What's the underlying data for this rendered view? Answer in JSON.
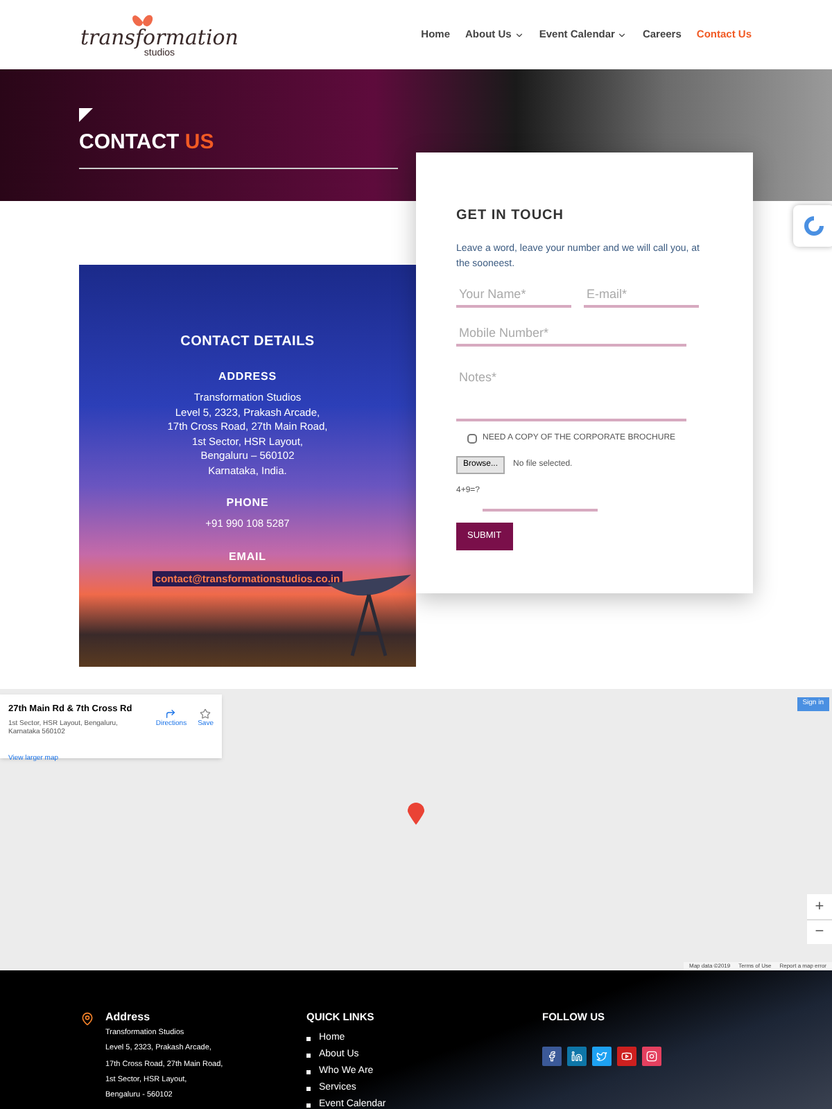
{
  "nav": {
    "logo": {
      "name": "transformation",
      "sub": "studios"
    },
    "items": [
      {
        "label": "Home",
        "selected": false,
        "dropdown": false
      },
      {
        "label": "About Us",
        "selected": false,
        "dropdown": true
      },
      {
        "label": "Event Calendar",
        "selected": false,
        "dropdown": true
      },
      {
        "label": "Careers",
        "selected": false,
        "dropdown": false
      },
      {
        "label": "Contact Us",
        "selected": true,
        "dropdown": false
      }
    ]
  },
  "banner": {
    "title": "CONTACT",
    "title_accent": "US"
  },
  "contact_details": {
    "heading": "CONTACT DETAILS",
    "sections": [
      {
        "heading": "ADDRESS",
        "kind": "text",
        "lines": [
          "Transformation Studios",
          "Level 5, 2323, Prakash Arcade,",
          "17th Cross Road, 27th Main Road,",
          "1st Sector, HSR Layout,",
          "Bengaluru – 560102",
          "Karnataka, India."
        ]
      },
      {
        "heading": "PHONE",
        "kind": "text",
        "lines": [
          "+91 990 108 5287"
        ]
      },
      {
        "heading": "EMAIL",
        "kind": "link",
        "lines": [
          "contact@transformationstudios.co.in"
        ]
      }
    ]
  },
  "form": {
    "heading": "GET IN TOUCH",
    "intro": "Leave a word, leave your number and we will call you, at the sooneest.",
    "fields": [
      {
        "placeholder": "Your Name*",
        "kind": "half"
      },
      {
        "placeholder": "E-mail*",
        "kind": "half"
      },
      {
        "placeholder": "Mobile Number*",
        "kind": "full"
      },
      {
        "placeholder": "Notes*",
        "kind": "textarea"
      }
    ],
    "checkbox": {
      "label": "NEED A COPY OF THE CORPORATE BROCHURE",
      "checked": false
    },
    "file": {
      "button": "Browse...",
      "status": "No file selected."
    },
    "captcha": {
      "question": "4+9=?"
    },
    "submit": "SUBMIT"
  },
  "map": {
    "info": {
      "title": "27th Main Rd & 7th Cross Rd",
      "address": "1st Sector, HSR Layout, Bengaluru, Karnataka 560102",
      "directions": "Directions",
      "save": "Save",
      "link": "View larger map"
    },
    "sign_in": "Sign in",
    "zoom_in": "+",
    "zoom_out": "−",
    "attribution": [
      "Map data ©2019",
      "Terms of Use",
      "Report a map error"
    ]
  },
  "footer": {
    "address": {
      "heading": "Address",
      "lines": [
        "Transformation Studios",
        "Level 5, 2323, Prakash Arcade,",
        "17th Cross Road, 27th Main Road,",
        "1st Sector, HSR Layout,",
        "Bengaluru - 560102"
      ]
    },
    "quick_links": {
      "heading": "QUICK LINKS",
      "items": [
        "Home",
        "About Us",
        "Who We Are",
        "Services",
        "Event Calendar"
      ]
    },
    "follow": {
      "heading": "FOLLOW US",
      "icons": [
        {
          "kind": "facebook",
          "color": "#3b5998"
        },
        {
          "kind": "linkedin",
          "color": "#0e76a8"
        },
        {
          "kind": "twitter",
          "color": "#1da1f2"
        },
        {
          "kind": "youtube",
          "color": "#cd201f"
        },
        {
          "kind": "instagram",
          "color": "#e4405f"
        }
      ]
    }
  }
}
